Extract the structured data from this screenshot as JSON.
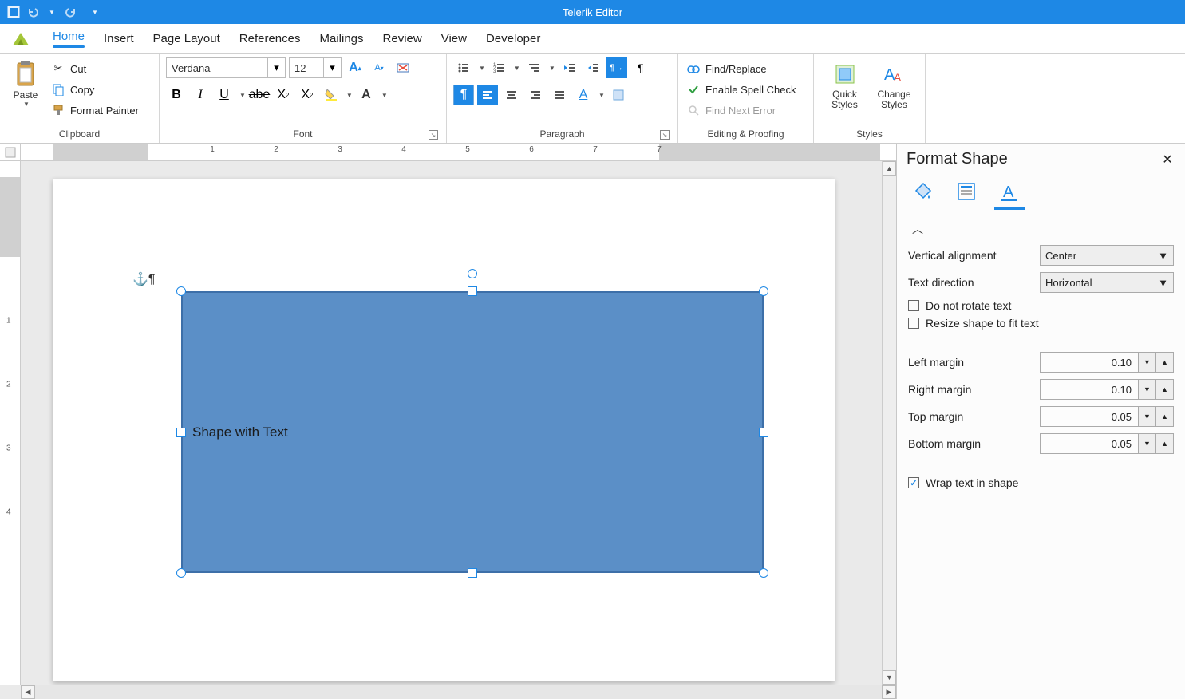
{
  "app": {
    "title": "Telerik Editor"
  },
  "tabs": {
    "home": "Home",
    "insert": "Insert",
    "page_layout": "Page Layout",
    "references": "References",
    "mailings": "Mailings",
    "review": "Review",
    "view": "View",
    "developer": "Developer"
  },
  "ribbon": {
    "clipboard": {
      "label": "Clipboard",
      "paste": "Paste",
      "cut": "Cut",
      "copy": "Copy",
      "format_painter": "Format Painter"
    },
    "font": {
      "label": "Font",
      "family": "Verdana",
      "size": "12"
    },
    "paragraph": {
      "label": "Paragraph"
    },
    "proofing": {
      "label": "Editing & Proofing",
      "find_replace": "Find/Replace",
      "spell_check": "Enable Spell Check",
      "find_next": "Find Next Error"
    },
    "styles": {
      "label": "Styles",
      "quick": "Quick\nStyles",
      "change": "Change\nStyles"
    }
  },
  "document": {
    "shape_text": "Shape with Text"
  },
  "panel": {
    "title": "Format Shape",
    "vertical_alignment_label": "Vertical alignment",
    "vertical_alignment_value": "Center",
    "text_direction_label": "Text direction",
    "text_direction_value": "Horizontal",
    "do_not_rotate": "Do not rotate text",
    "resize_to_fit": "Resize shape to fit text",
    "left_margin_label": "Left margin",
    "left_margin_value": "0.10",
    "right_margin_label": "Right margin",
    "right_margin_value": "0.10",
    "top_margin_label": "Top margin",
    "top_margin_value": "0.05",
    "bottom_margin_label": "Bottom margin",
    "bottom_margin_value": "0.05",
    "wrap_text": "Wrap text in shape"
  }
}
